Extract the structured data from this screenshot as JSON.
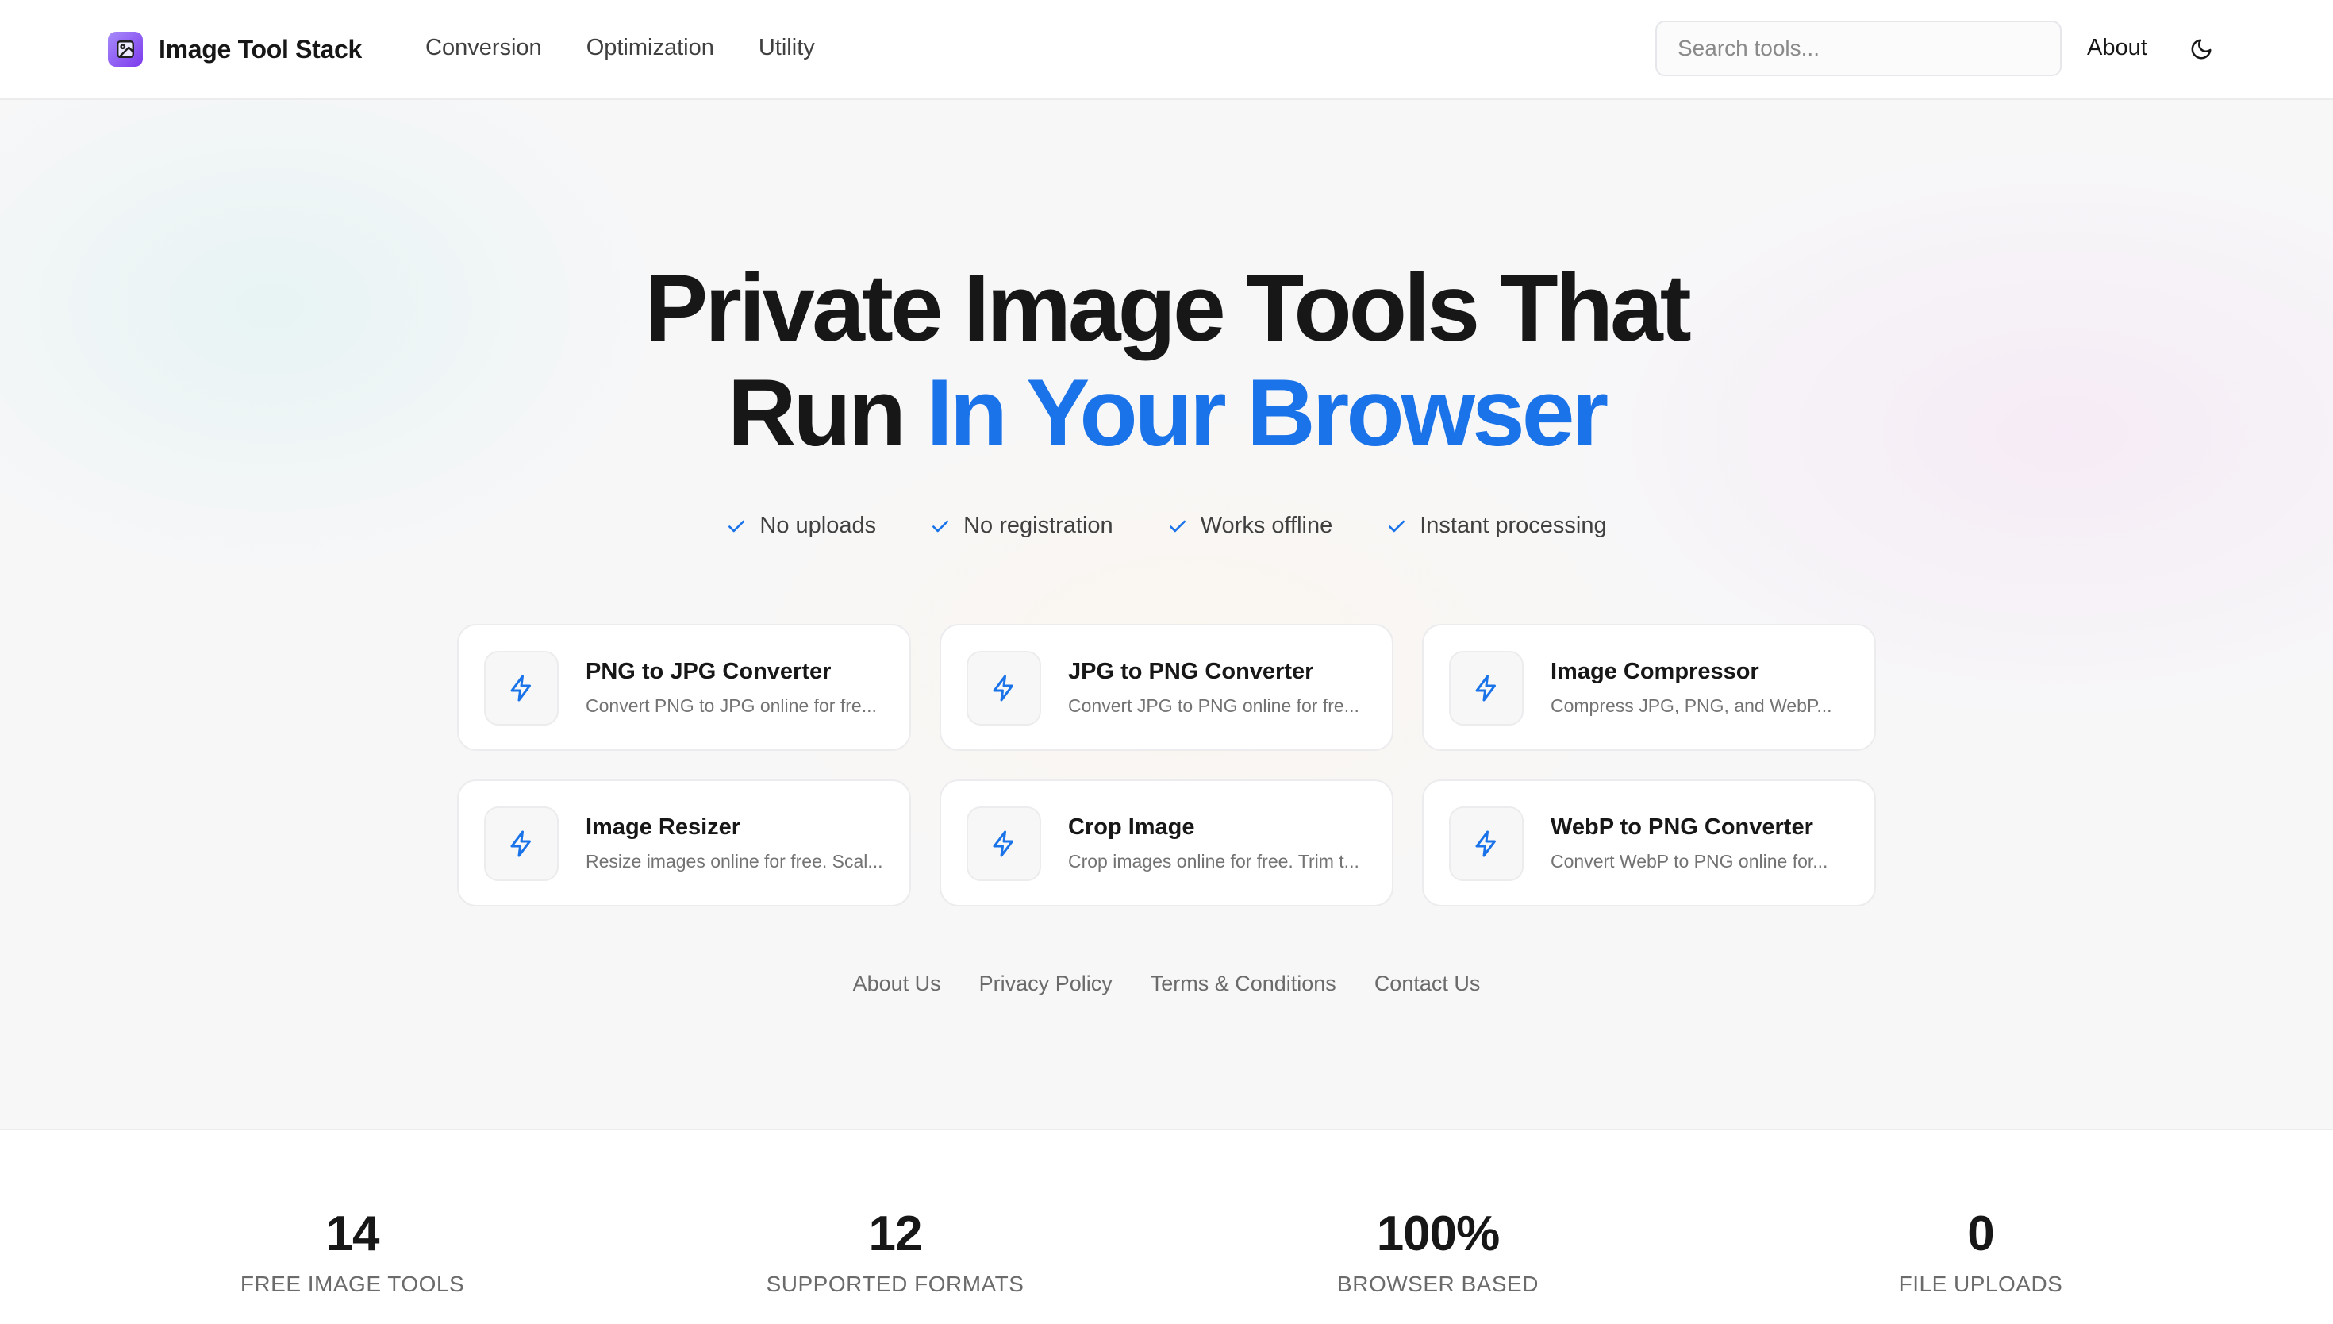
{
  "header": {
    "logo_text": "Image Tool Stack",
    "nav": [
      {
        "label": "Conversion"
      },
      {
        "label": "Optimization"
      },
      {
        "label": "Utility"
      }
    ],
    "search_placeholder": "Search tools...",
    "about_label": "About",
    "theme_icon": "moon-icon"
  },
  "hero": {
    "title_line1": "Private Image Tools That",
    "title_line2_plain": "Run ",
    "title_line2_accent": "In Your Browser",
    "accent_color": "#1a73e8",
    "features": [
      {
        "label": "No uploads"
      },
      {
        "label": "No registration"
      },
      {
        "label": "Works offline"
      },
      {
        "label": "Instant processing"
      }
    ]
  },
  "tools": [
    {
      "title": "PNG to JPG Converter",
      "desc": "Convert PNG to JPG online for fre...",
      "icon": "lightning-icon"
    },
    {
      "title": "JPG to PNG Converter",
      "desc": "Convert JPG to PNG online for fre...",
      "icon": "lightning-icon"
    },
    {
      "title": "Image Compressor",
      "desc": "Compress JPG, PNG, and WebP...",
      "icon": "lightning-icon"
    },
    {
      "title": "Image Resizer",
      "desc": "Resize images online for free. Scal...",
      "icon": "lightning-icon"
    },
    {
      "title": "Crop Image",
      "desc": "Crop images online for free. Trim t...",
      "icon": "lightning-icon"
    },
    {
      "title": "WebP to PNG Converter",
      "desc": "Convert WebP to PNG online for...",
      "icon": "lightning-icon"
    }
  ],
  "footer_links": [
    {
      "label": "About Us"
    },
    {
      "label": "Privacy Policy"
    },
    {
      "label": "Terms & Conditions"
    },
    {
      "label": "Contact Us"
    }
  ],
  "stats": [
    {
      "value": "14",
      "label": "FREE IMAGE TOOLS"
    },
    {
      "value": "12",
      "label": "SUPPORTED FORMATS"
    },
    {
      "value": "100%",
      "label": "BROWSER BASED"
    },
    {
      "value": "0",
      "label": "FILE UPLOADS"
    }
  ]
}
